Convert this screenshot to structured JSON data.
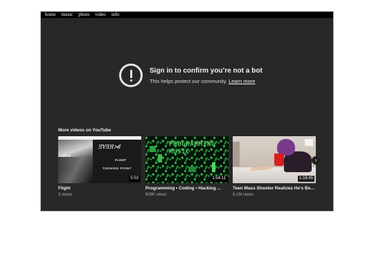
{
  "nav": {
    "items": [
      "home",
      "music",
      "photo",
      "video",
      "info"
    ]
  },
  "notice": {
    "title": "Sign in to confirm you’re not a bot",
    "subtitle": "This helps protect our community.",
    "link": "Learn more",
    "icon": "alert-circle-icon"
  },
  "more": {
    "label": "More videos on YouTube",
    "videos": [
      {
        "title": "Flight",
        "views": "3 views",
        "duration": "5:53",
        "thumb_text": [
          "FLIGHT",
          "TURNING POINT"
        ]
      },
      {
        "title": "Programming • Coding • Hacking ...",
        "views": "909K views",
        "duration": "1:54:11",
        "thumb_text": "PROGRAMMING MUSIC"
      },
      {
        "title": "Teen Mass Shooter Realizes He's Bee...",
        "views": "6.1M views",
        "duration": "1:18:45"
      }
    ],
    "next_icon": "chevron-right-icon"
  },
  "colors": {
    "background": "#282828",
    "text": "#f1f1f1",
    "muted": "#aaaaaa"
  }
}
